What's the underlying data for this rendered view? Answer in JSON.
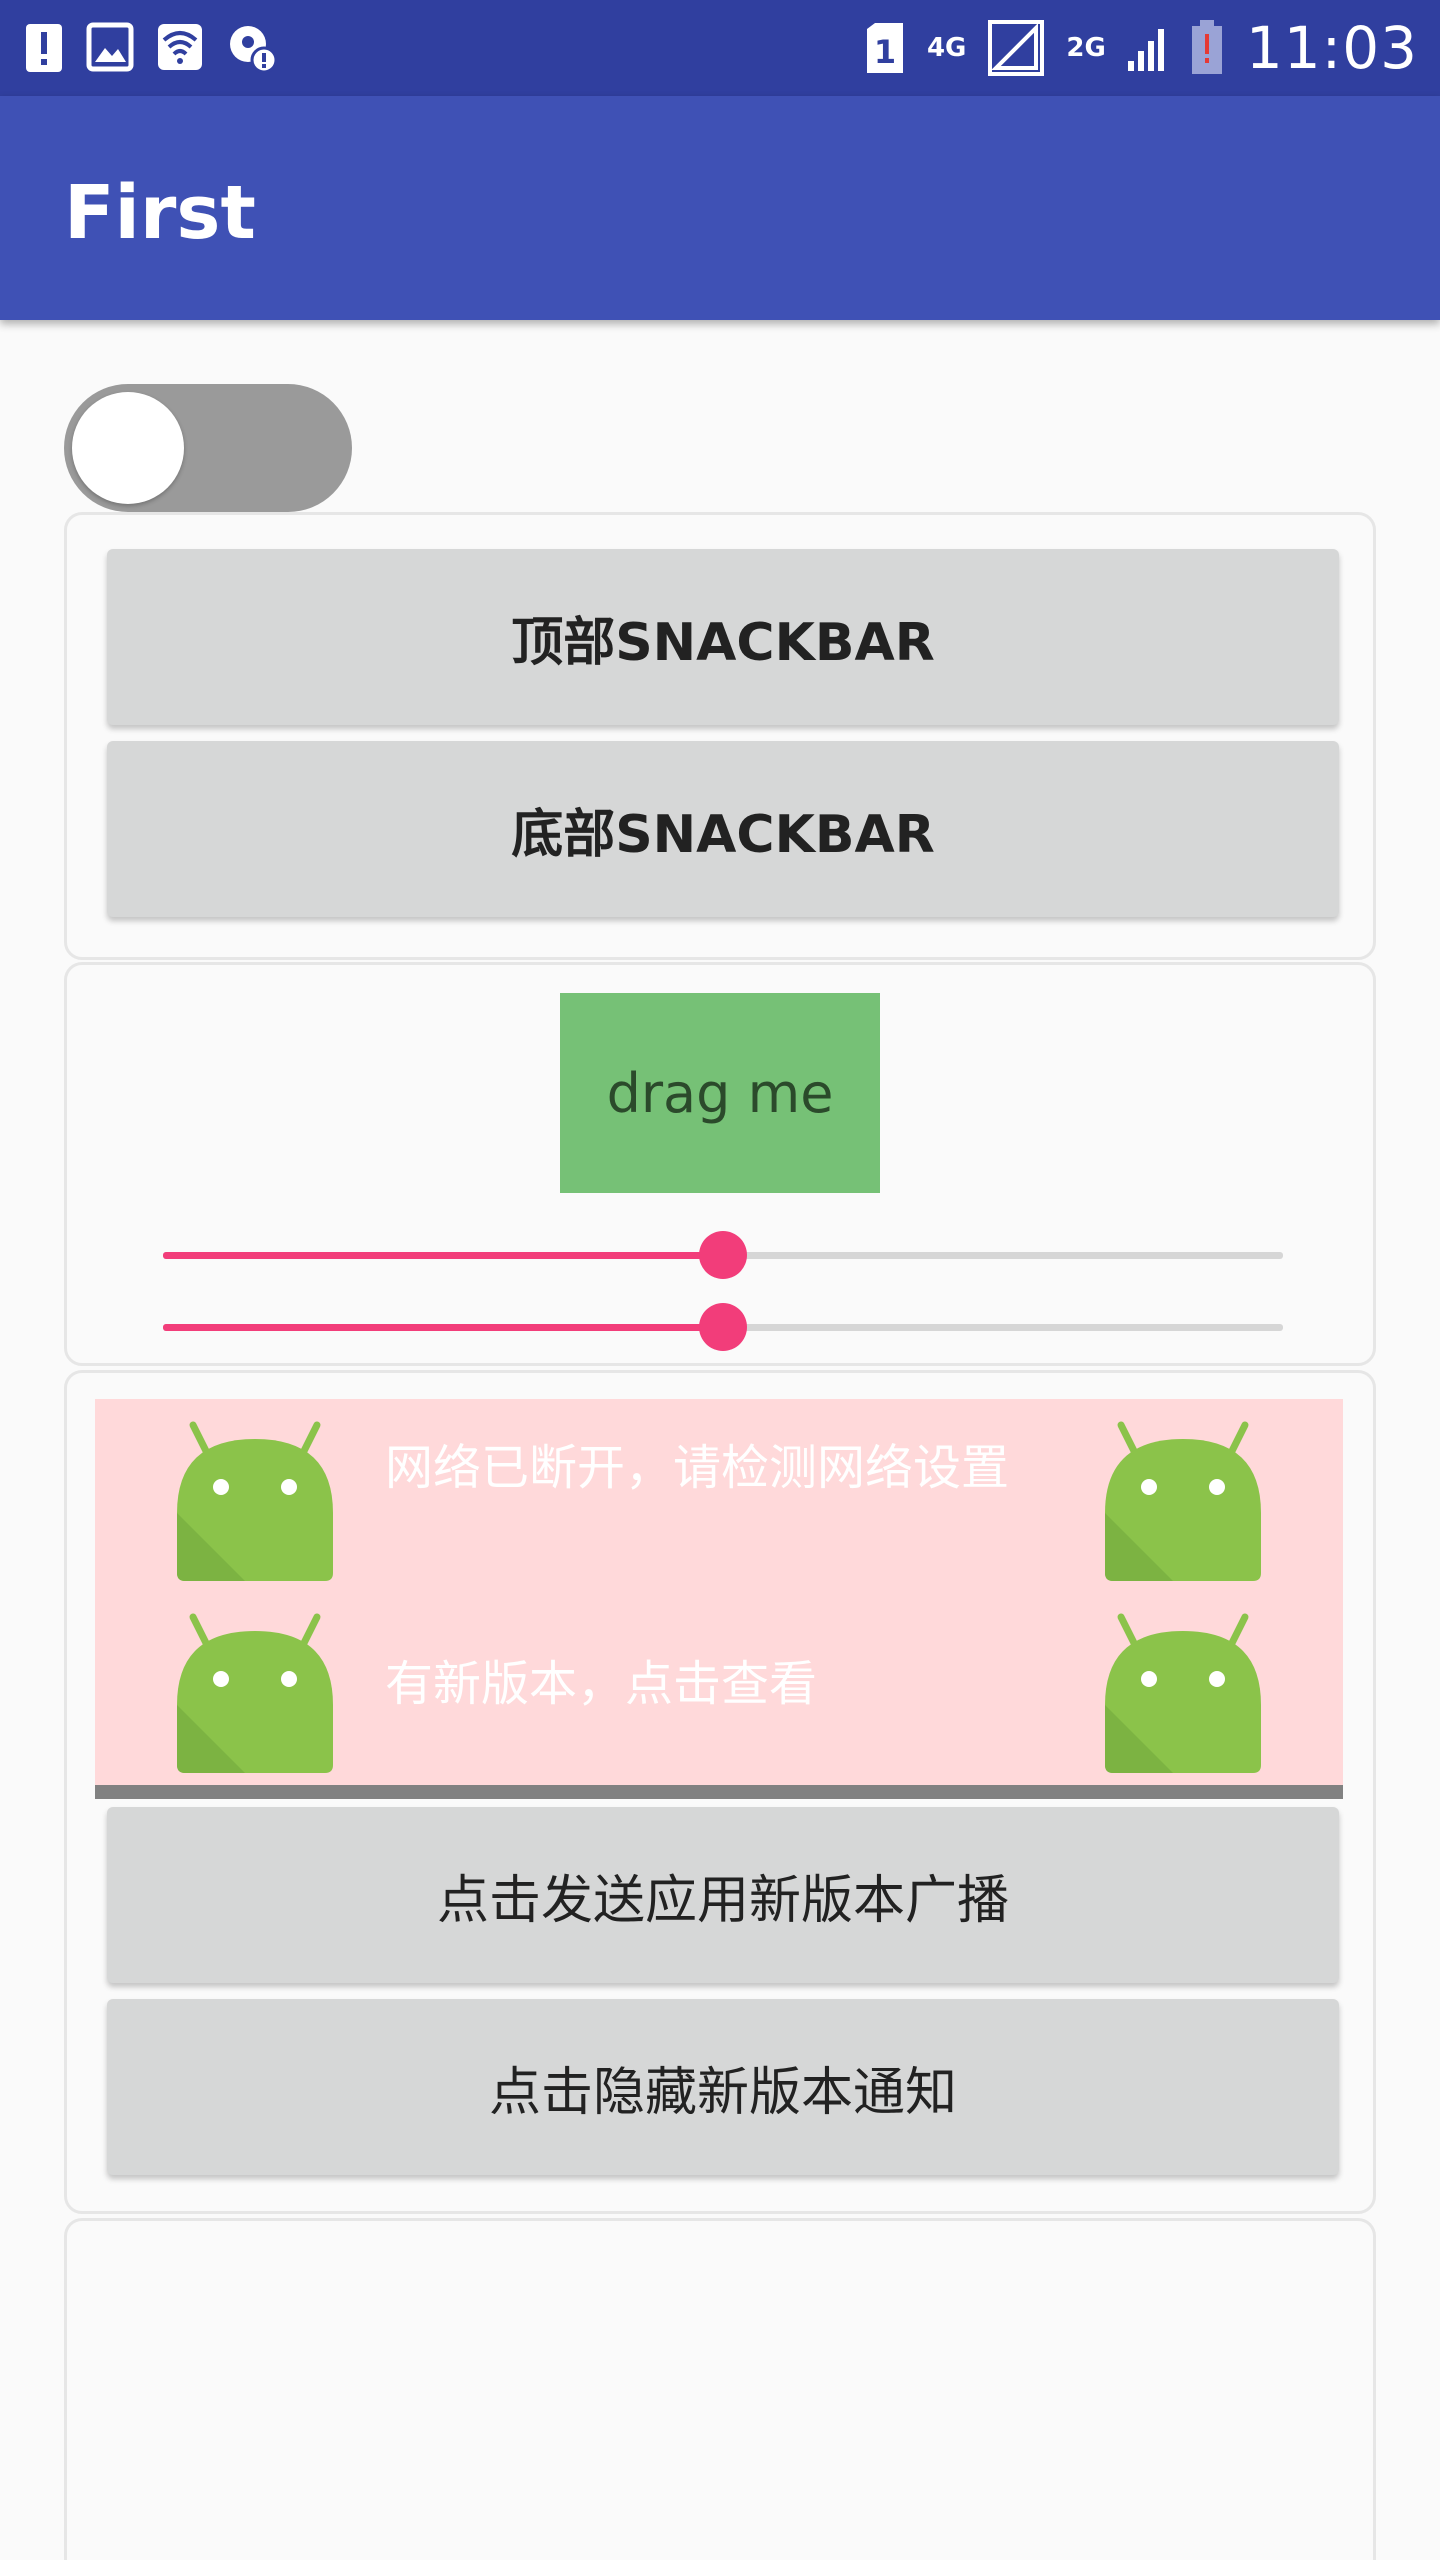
{
  "status_bar": {
    "time": "11:03",
    "sim_slot": "1",
    "network_4g": "4G",
    "network_2g": "2G"
  },
  "app_bar": {
    "title": "First"
  },
  "switch": {
    "checked": false
  },
  "snackbar_card": {
    "top_button": "顶部SNACKBAR",
    "bottom_button": "底部SNACKBAR"
  },
  "drag_card": {
    "drag_label": "drag me",
    "sliders": [
      {
        "value": 0.5
      },
      {
        "value": 0.5
      }
    ]
  },
  "notice_card": {
    "notices": [
      {
        "text": "网络已断开，请检测网络设置",
        "icon": "android-icon"
      },
      {
        "text": "有新版本，点击查看",
        "icon": "android-icon"
      }
    ],
    "send_button": "点击发送应用新版本广播",
    "hide_button": "点击隐藏新版本通知"
  },
  "colors": {
    "status_bar": "#303f9f",
    "app_bar": "#3f51b5",
    "accent": "#f23d7a",
    "drag_box": "#76c176",
    "notice_bg": "#ffd9da",
    "android_green": "#8bc34a"
  }
}
